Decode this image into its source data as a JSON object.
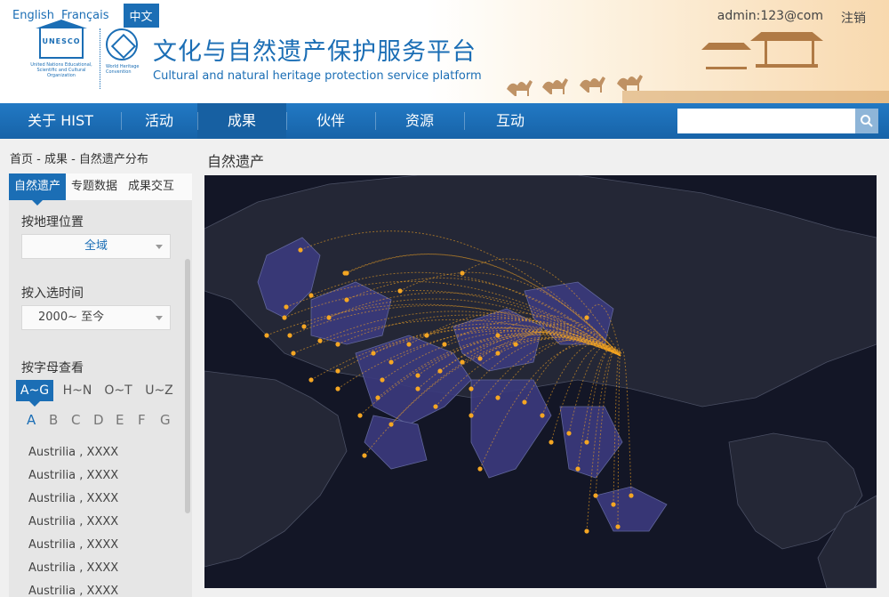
{
  "header": {
    "languages": [
      "English",
      "Français"
    ],
    "active_language": "中文",
    "user_email": "admin:123@com",
    "logout": "注销",
    "title_cn": "文化与自然遗产保护服务平台",
    "title_en": "Cultural and natural heritage protection service platform",
    "unesco_short": "UNESCO",
    "unesco_text": "United Nations Educational, Scientific and Cultural Organization",
    "whc_text": "World Heritage Convention"
  },
  "nav": {
    "items": [
      "关于 HIST",
      "活动",
      "成果",
      "伙伴",
      "资源",
      "互动"
    ],
    "active_index": 2,
    "search_placeholder": ""
  },
  "sidebar": {
    "breadcrumb": "首页 - 成果 - 自然遗产分布",
    "tabs": [
      "自然遗产",
      "专题数据",
      "成果交互"
    ],
    "geo_label": "按地理位置",
    "geo_value": "全域",
    "time_label": "按入选时间",
    "time_value": "2000~ 至今",
    "alpha_label": "按字母查看",
    "alpha_groups": [
      "A~G",
      "H~N",
      "O~T",
      "U~Z"
    ],
    "letters": [
      "A",
      "B",
      "C",
      "D",
      "E",
      "F",
      "G"
    ],
    "results": [
      "Austrilia , XXXX",
      "Austrilia , XXXX",
      "Austrilia , XXXX",
      "Austrilia , XXXX",
      "Austrilia , XXXX",
      "Austrilia , XXXX",
      "Austrilia , XXXX"
    ]
  },
  "main": {
    "title": "自然遗产"
  },
  "colors": {
    "primary": "#1b6eb5",
    "map_bg": "#131626",
    "map_land": "#242736",
    "map_highlight": "#3b3a7e",
    "flow": "#f5a623"
  }
}
